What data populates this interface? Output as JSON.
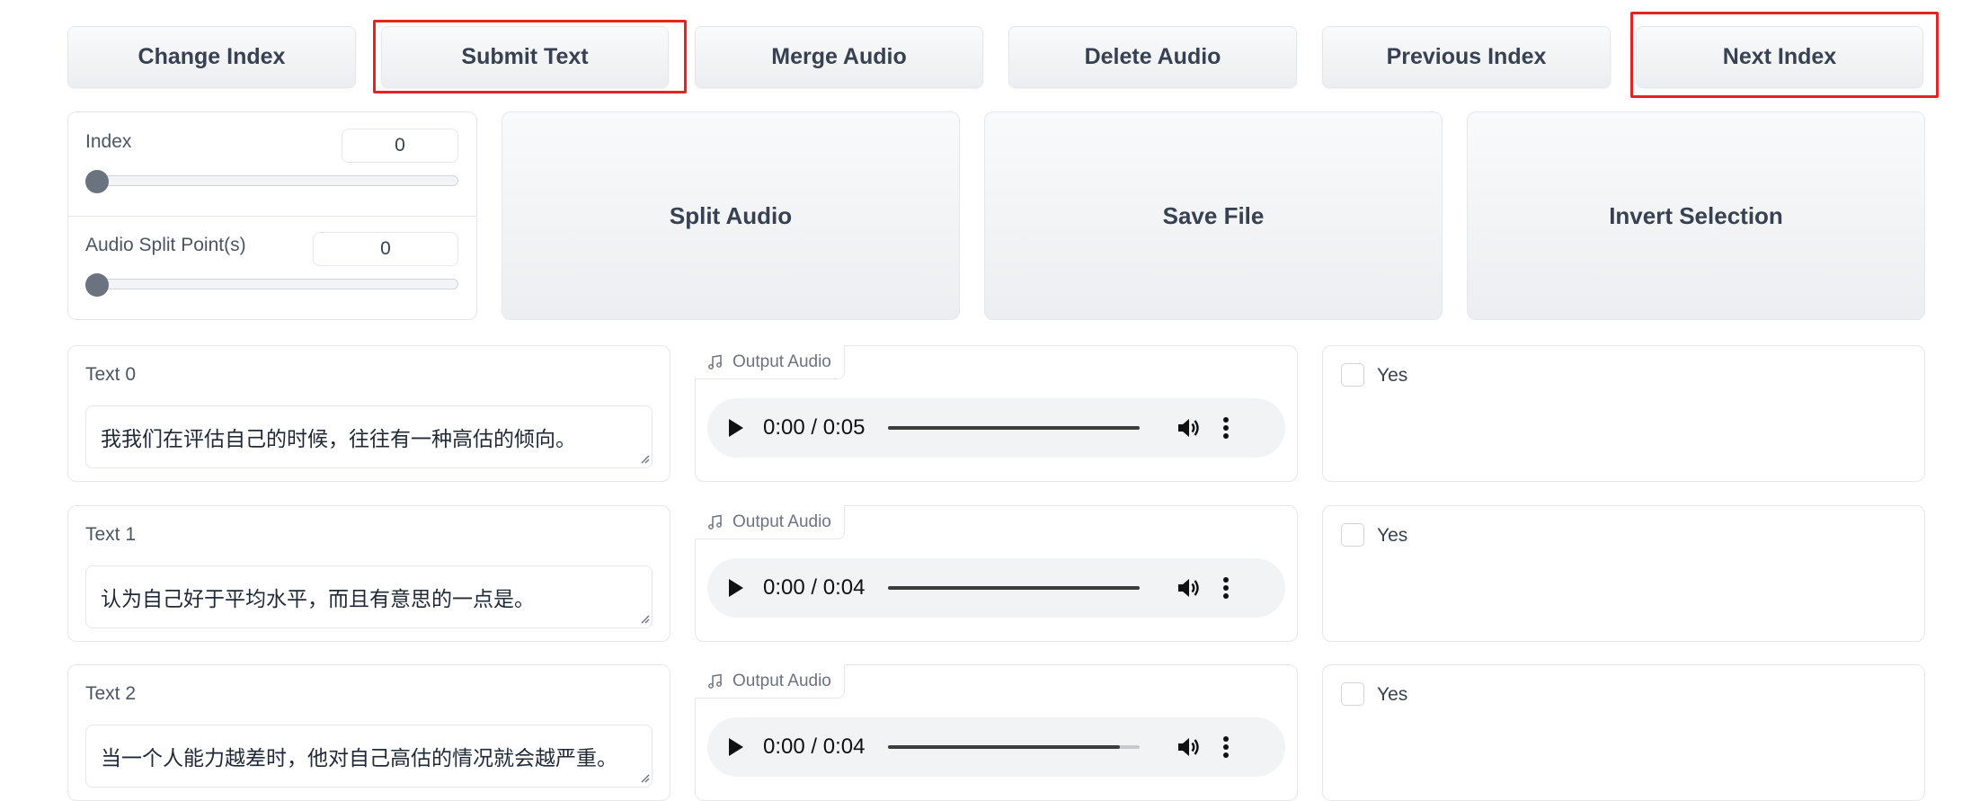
{
  "toolbar": {
    "change_index": "Change Index",
    "submit_text": "Submit Text",
    "merge_audio": "Merge Audio",
    "delete_audio": "Delete Audio",
    "previous_index": "Previous Index",
    "next_index": "Next Index"
  },
  "sliders": {
    "index": {
      "label": "Index",
      "value": "0"
    },
    "split": {
      "label": "Audio Split Point(s)",
      "value": "0"
    }
  },
  "actions": {
    "split_audio": "Split Audio",
    "save_file": "Save File",
    "invert_selection": "Invert Selection"
  },
  "rows": [
    {
      "text_label": "Text 0",
      "text": "我我们在评估自己的时候，往往有一种高估的倾向。",
      "audio_label": "Output Audio",
      "time": "0:00 / 0:05",
      "progress": 1.0,
      "checkbox_label": "Yes",
      "checked": false
    },
    {
      "text_label": "Text 1",
      "text": "认为自己好于平均水平，而且有意思的一点是。",
      "audio_label": "Output Audio",
      "time": "0:00 / 0:04",
      "progress": 1.0,
      "checkbox_label": "Yes",
      "checked": false
    },
    {
      "text_label": "Text 2",
      "text": "当一个人能力越差时，他对自己高估的情况就会越严重。",
      "audio_label": "Output Audio",
      "time": "0:00 / 0:04",
      "progress": 0.92,
      "checkbox_label": "Yes",
      "checked": false
    }
  ],
  "colors": {
    "highlight": "#e5241f",
    "accent_thumb": "#6b7280"
  }
}
